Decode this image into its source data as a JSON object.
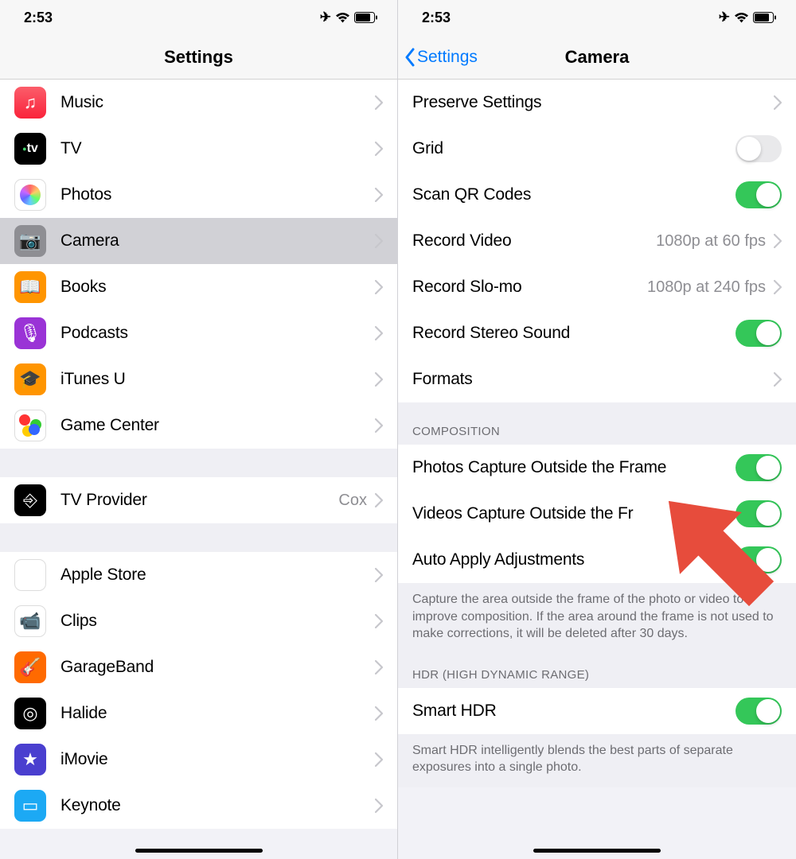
{
  "left": {
    "time": "2:53",
    "title": "Settings",
    "group1": [
      {
        "name": "music",
        "label": "Music",
        "iconClass": "ic-music",
        "glyph": "♫"
      },
      {
        "name": "tv",
        "label": "TV",
        "iconClass": "ic-tv",
        "glyph": "⦿tv"
      },
      {
        "name": "photos",
        "label": "Photos",
        "iconClass": "ic-photos",
        "glyph": "✿"
      },
      {
        "name": "camera",
        "label": "Camera",
        "iconClass": "ic-camera",
        "glyph": "📷",
        "selected": true
      },
      {
        "name": "books",
        "label": "Books",
        "iconClass": "ic-books",
        "glyph": "📖"
      },
      {
        "name": "podcasts",
        "label": "Podcasts",
        "iconClass": "ic-podcasts",
        "glyph": "🎙"
      },
      {
        "name": "itunesu",
        "label": "iTunes U",
        "iconClass": "ic-itunesu",
        "glyph": "🎓"
      },
      {
        "name": "gamecenter",
        "label": "Game Center",
        "iconClass": "ic-gamecenter",
        "glyph": "●"
      }
    ],
    "group2": [
      {
        "name": "tvprovider",
        "label": "TV Provider",
        "iconClass": "ic-tvprovider",
        "glyph": "⎆",
        "value": "Cox"
      }
    ],
    "group3": [
      {
        "name": "applestore",
        "label": "Apple Store",
        "iconClass": "ic-applestore",
        "glyph": "🛍"
      },
      {
        "name": "clips",
        "label": "Clips",
        "iconClass": "ic-clips",
        "glyph": "📹"
      },
      {
        "name": "garageband",
        "label": "GarageBand",
        "iconClass": "ic-garageband",
        "glyph": "🎸"
      },
      {
        "name": "halide",
        "label": "Halide",
        "iconClass": "ic-halide",
        "glyph": "◎"
      },
      {
        "name": "imovie",
        "label": "iMovie",
        "iconClass": "ic-imovie",
        "glyph": "★"
      },
      {
        "name": "keynote",
        "label": "Keynote",
        "iconClass": "ic-keynote",
        "glyph": "▭"
      }
    ]
  },
  "right": {
    "time": "2:53",
    "back": "Settings",
    "title": "Camera",
    "rows1": [
      {
        "name": "preserve-settings",
        "label": "Preserve Settings",
        "type": "disclosure"
      },
      {
        "name": "grid",
        "label": "Grid",
        "type": "toggle",
        "on": false
      },
      {
        "name": "scan-qr",
        "label": "Scan QR Codes",
        "type": "toggle",
        "on": true
      },
      {
        "name": "record-video",
        "label": "Record Video",
        "type": "disclosure",
        "value": "1080p at 60 fps"
      },
      {
        "name": "record-slomo",
        "label": "Record Slo-mo",
        "type": "disclosure",
        "value": "1080p at 240 fps"
      },
      {
        "name": "record-stereo",
        "label": "Record Stereo Sound",
        "type": "toggle",
        "on": true
      },
      {
        "name": "formats",
        "label": "Formats",
        "type": "disclosure"
      }
    ],
    "compositionHeader": "COMPOSITION",
    "rows2": [
      {
        "name": "photos-outside-frame",
        "label": "Photos Capture Outside the Frame",
        "type": "toggle",
        "on": true
      },
      {
        "name": "videos-outside-frame",
        "label": "Videos Capture Outside the Fr",
        "type": "toggle",
        "on": true
      },
      {
        "name": "auto-apply",
        "label": "Auto Apply Adjustments",
        "type": "toggle",
        "on": true
      }
    ],
    "compositionFooter": "Capture the area outside the frame of the photo or video to improve composition. If the area around the frame is not used to make corrections, it will be deleted after 30 days.",
    "hdrHeader": "HDR (HIGH DYNAMIC RANGE)",
    "rows3": [
      {
        "name": "smart-hdr",
        "label": "Smart HDR",
        "type": "toggle",
        "on": true
      }
    ],
    "hdrFooter": "Smart HDR intelligently blends the best parts of separate exposures into a single photo."
  }
}
